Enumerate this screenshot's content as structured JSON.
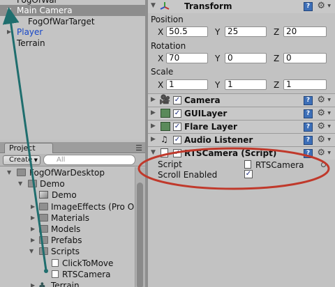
{
  "hierarchy": {
    "items": [
      {
        "label": "FogOfWar",
        "indent": 0,
        "expandable": false,
        "selected": false,
        "color": "#111111"
      },
      {
        "label": "Main Camera",
        "indent": 0,
        "expandable": true,
        "selected": true,
        "color": "#ffffff"
      },
      {
        "label": "FogOfWarTarget",
        "indent": 1,
        "expandable": false,
        "selected": false,
        "color": "#111111"
      },
      {
        "label": "Player",
        "indent": 0,
        "expandable": true,
        "selected": false,
        "color": "#1546c8"
      },
      {
        "label": "Terrain",
        "indent": 0,
        "expandable": false,
        "selected": false,
        "color": "#111111"
      }
    ]
  },
  "project": {
    "tab_label": "Project",
    "menu_icon": "panel-menu-icon",
    "create_label": "Create",
    "search_placeholder": "All",
    "items": [
      {
        "label": "FogOfWarDesktop",
        "icon": "folder-icon"
      },
      {
        "label": "Demo",
        "icon": "folder-icon"
      },
      {
        "label": "Demo",
        "icon": "scene-icon"
      },
      {
        "label": "ImageEffects (Pro On",
        "icon": "folder-icon"
      },
      {
        "label": "Materials",
        "icon": "folder-icon"
      },
      {
        "label": "Models",
        "icon": "folder-icon"
      },
      {
        "label": "Prefabs",
        "icon": "folder-icon"
      },
      {
        "label": "Scripts",
        "icon": "folder-icon"
      },
      {
        "label": "ClickToMove",
        "icon": "script-file-icon"
      },
      {
        "label": "RTSCamera",
        "icon": "script-file-icon"
      },
      {
        "label": "Terrain",
        "icon": "terrain-icon"
      }
    ]
  },
  "inspector": {
    "transform": {
      "title": "Transform",
      "position_label": "Position",
      "rotation_label": "Rotation",
      "scale_label": "Scale",
      "axis_x": "X",
      "axis_y": "Y",
      "axis_z": "Z",
      "position": {
        "x": "50.5",
        "y": "25",
        "z": "20"
      },
      "rotation": {
        "x": "70",
        "y": "0",
        "z": "0"
      },
      "scale": {
        "x": "1",
        "y": "1",
        "z": "1"
      }
    },
    "components": [
      {
        "title": "Camera",
        "enabled": true
      },
      {
        "title": "GUILayer",
        "enabled": true
      },
      {
        "title": "Flare Layer",
        "enabled": true
      },
      {
        "title": "Audio Listener",
        "enabled": true
      }
    ],
    "script_component": {
      "title": "RTSCamera (Script)",
      "enabled": true,
      "script_label": "Script",
      "script_value": "RTSCamera",
      "scroll_label": "Scroll Enabled",
      "scroll_enabled": true
    },
    "check_glyph": "✓",
    "help_glyph": "?"
  },
  "annotation": {
    "arrow_color": "#1f6e6e",
    "ellipse_color": "#c0392b"
  }
}
